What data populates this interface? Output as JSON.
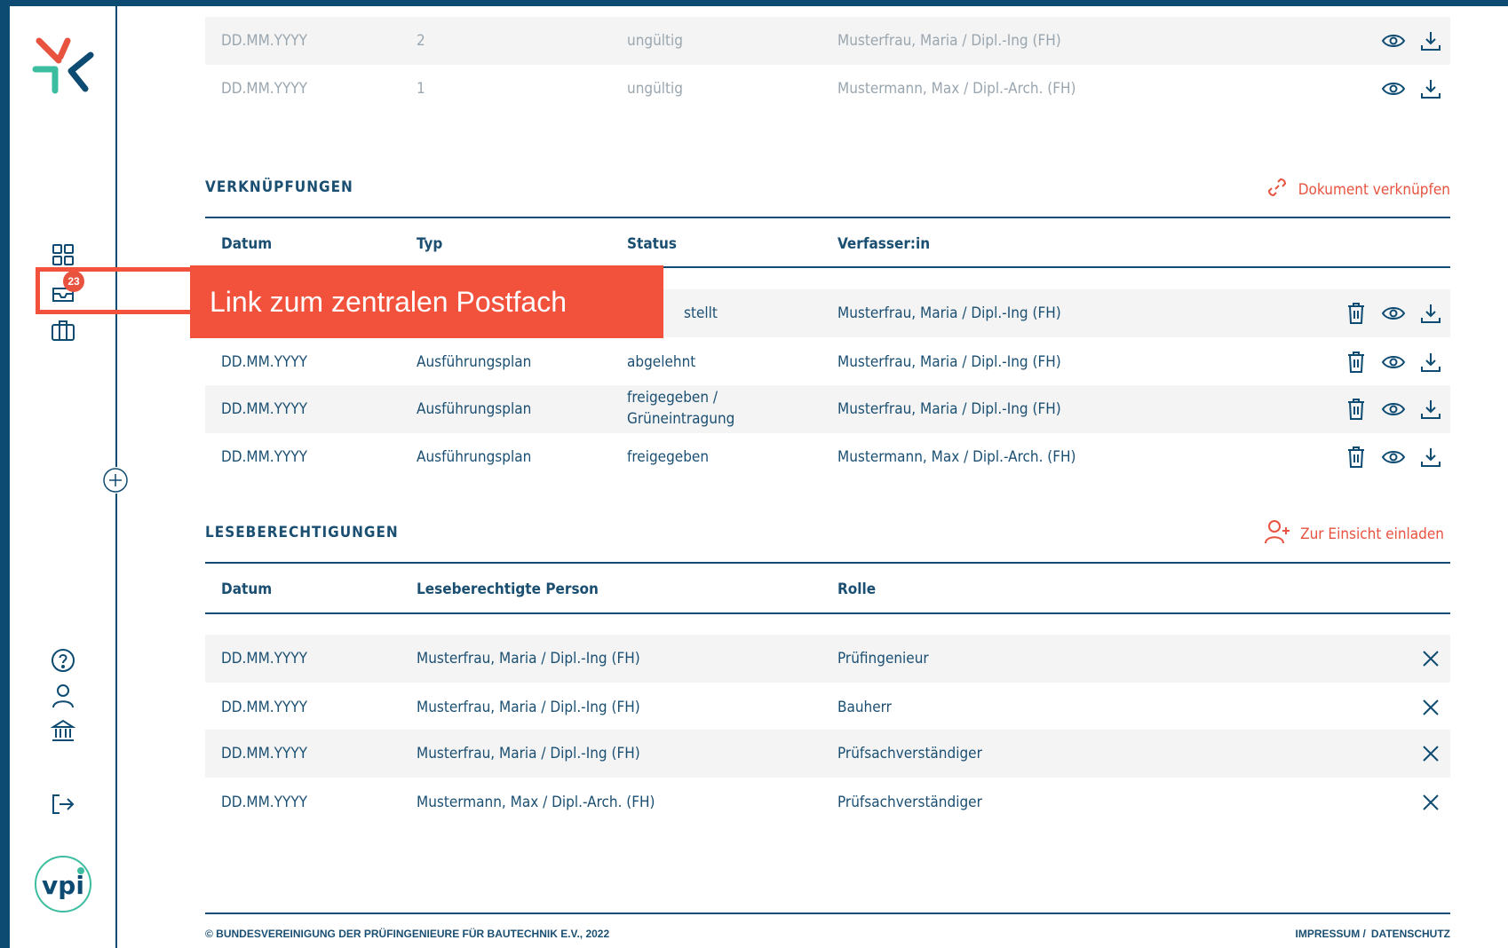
{
  "colors": {
    "primary": "#0e4b72",
    "accent": "#e8533f",
    "muted": "#9aa6af",
    "rowShade": "#f4f4f4"
  },
  "sidebar": {
    "icons": [
      "dashboard-icon",
      "inbox-icon",
      "briefcase-icon",
      "help-icon",
      "user-icon",
      "institution-icon",
      "logout-icon"
    ],
    "inbox_badge": "23",
    "vpi_logo_text": "vpi"
  },
  "callout": {
    "text": "Link zum zentralen Postfach"
  },
  "versions": {
    "rows": [
      {
        "date": "DD.MM.YYYY",
        "number": "2",
        "status": "ungültig",
        "author": "Musterfrau, Maria / Dipl.-Ing (FH)"
      },
      {
        "date": "DD.MM.YYYY",
        "number": "1",
        "status": "ungültig",
        "author": "Mustermann, Max / Dipl.-Arch. (FH)"
      }
    ]
  },
  "links": {
    "title": "VERKNÜPFUNGEN",
    "action_label": "Dokument verknüpfen",
    "headers": {
      "date": "Datum",
      "type": "Typ",
      "status": "Status",
      "author": "Verfasser:in"
    },
    "rows": [
      {
        "date": "",
        "type": "",
        "status": "stellt",
        "author": "Musterfrau, Maria / Dipl.-Ing (FH)"
      },
      {
        "date": "DD.MM.YYYY",
        "type": "Ausführungsplan",
        "status": "abgelehnt",
        "author": "Musterfrau, Maria / Dipl.-Ing (FH)"
      },
      {
        "date": "DD.MM.YYYY",
        "type": "Ausführungsplan",
        "status_line1": "freigegeben /",
        "status_line2": "Grüneintragung",
        "author": "Musterfrau, Maria / Dipl.-Ing (FH)"
      },
      {
        "date": "DD.MM.YYYY",
        "type": "Ausführungsplan",
        "status": "freigegeben",
        "author": "Mustermann, Max / Dipl.-Arch. (FH)"
      }
    ]
  },
  "permissions": {
    "title": "LESEBERECHTIGUNGEN",
    "action_label": "Zur Einsicht einladen",
    "headers": {
      "date": "Datum",
      "person": "Leseberechtigte Person",
      "role": "Rolle"
    },
    "rows": [
      {
        "date": "DD.MM.YYYY",
        "person": "Musterfrau, Maria / Dipl.-Ing (FH)",
        "role": "Prüfingenieur"
      },
      {
        "date": "DD.MM.YYYY",
        "person": "Musterfrau, Maria / Dipl.-Ing (FH)",
        "role": "Bauherr"
      },
      {
        "date": "DD.MM.YYYY",
        "person": "Musterfrau, Maria / Dipl.-Ing (FH)",
        "role": "Prüfsachverständiger"
      },
      {
        "date": "DD.MM.YYYY",
        "person": "Mustermann, Max / Dipl.-Arch. (FH)",
        "role": "Prüfsachverständiger"
      }
    ]
  },
  "footer": {
    "copyright": "© BUNDESVEREINIGUNG DER PRÜFINGENIEURE FÜR BAUTECHNIK E.V., 2022",
    "impressum": "IMPRESSUM /",
    "datenschutz": "DATENSCHUTZ"
  }
}
